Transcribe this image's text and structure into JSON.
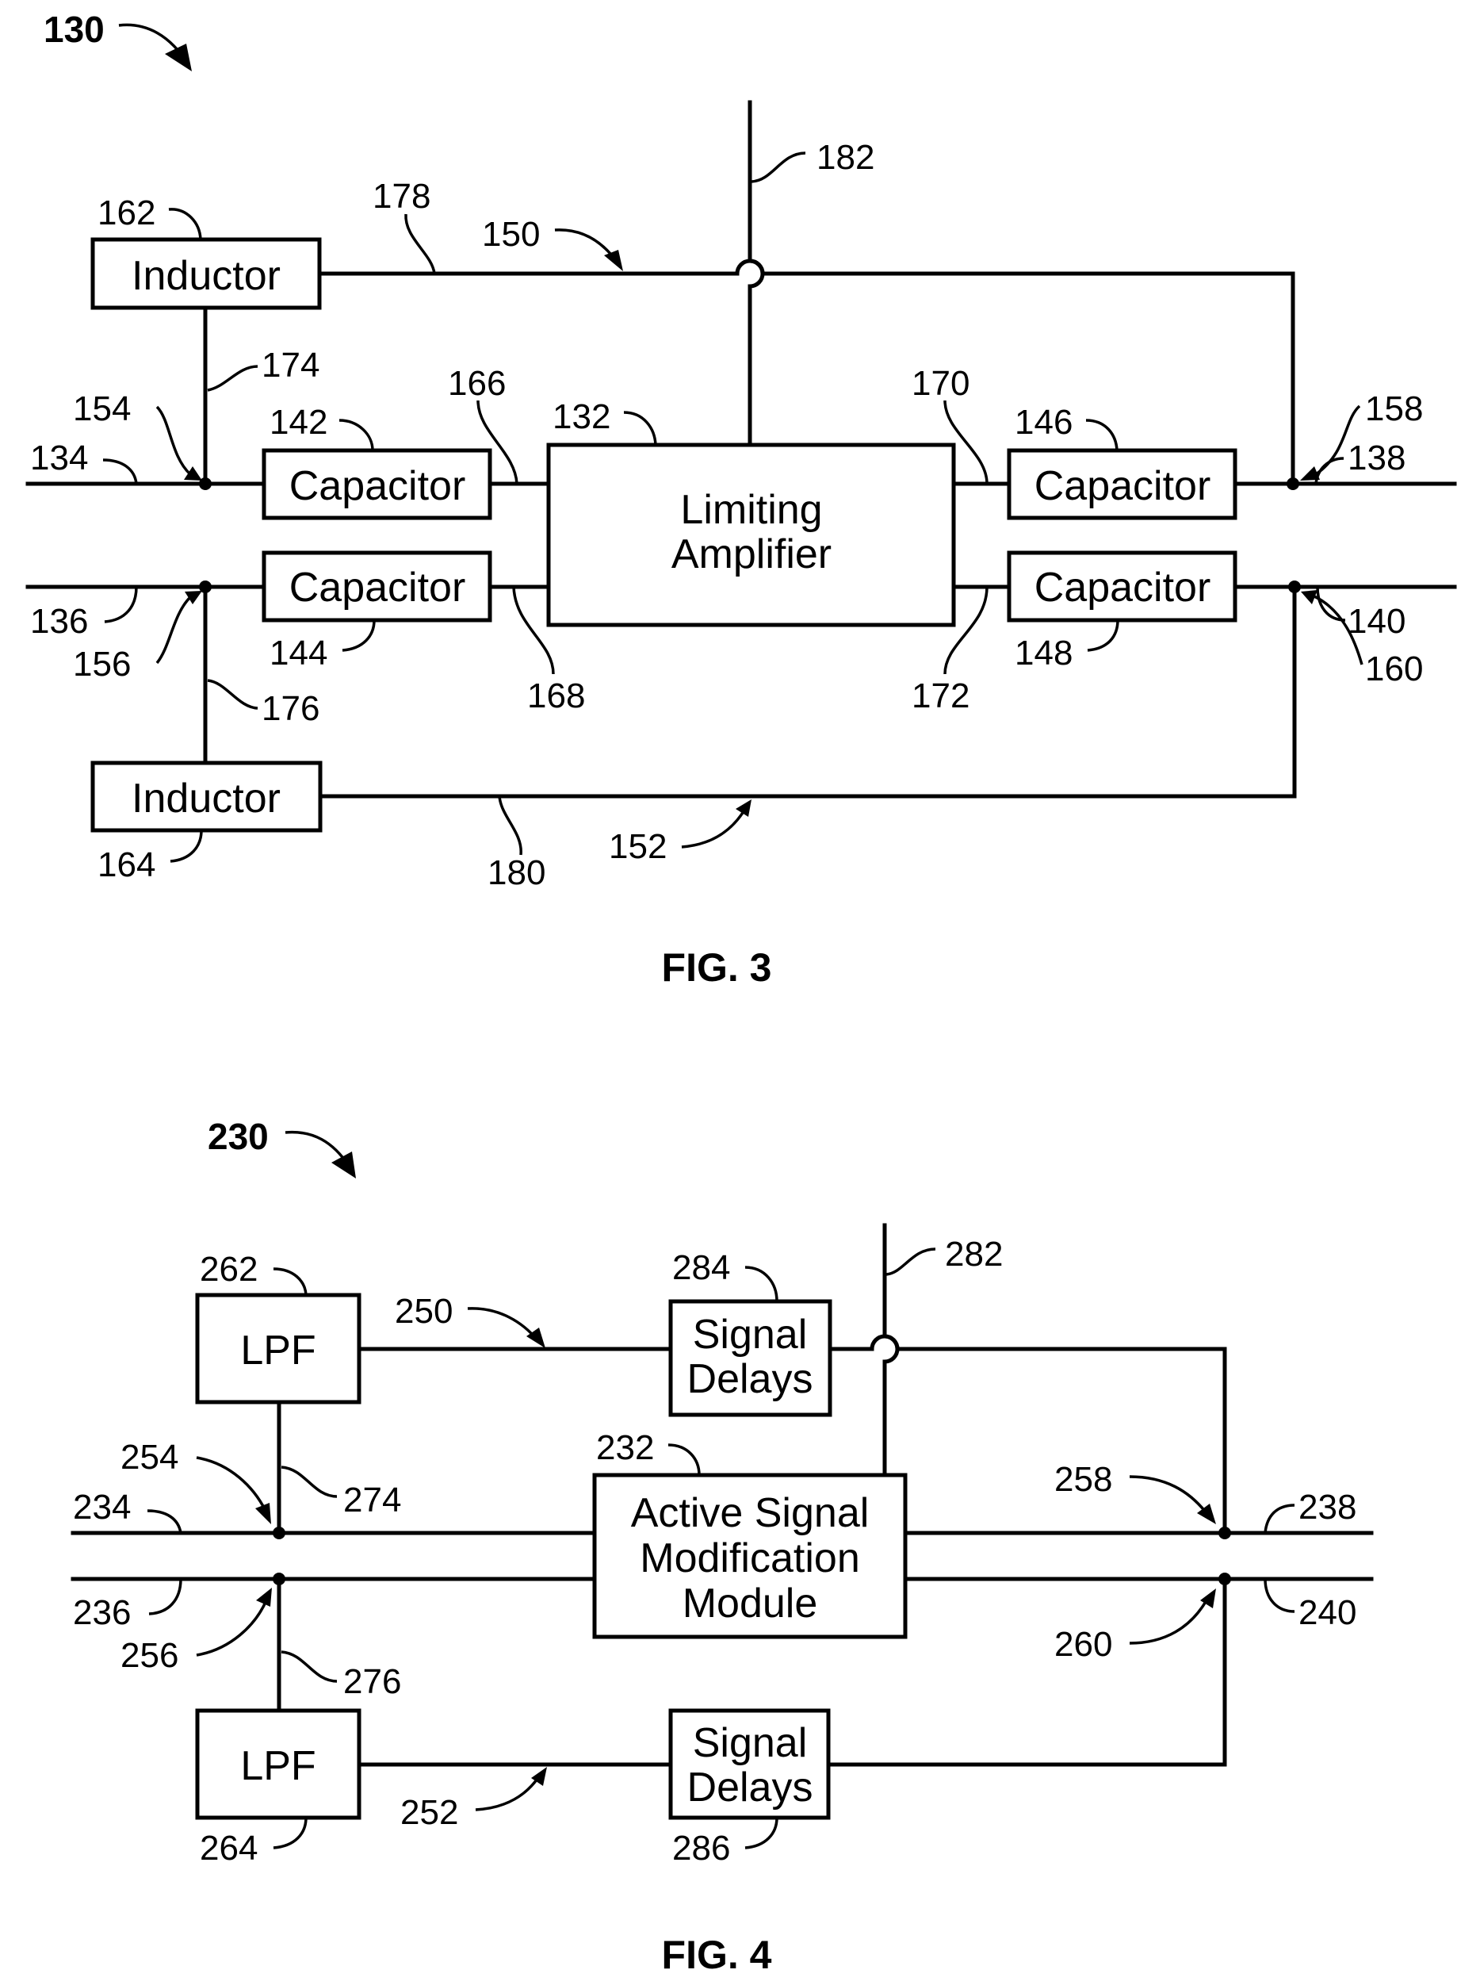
{
  "document": {
    "type": "patent-drawing-sheet",
    "figures": [
      {
        "id": "fig3",
        "caption": "FIG. 3",
        "assembly_ref": "130",
        "blocks": [
          {
            "key": "inductor_top",
            "label": "Inductor",
            "ref": "162"
          },
          {
            "key": "inductor_bottom",
            "label": "Inductor",
            "ref": "164"
          },
          {
            "key": "cap_in_top",
            "label": "Capacitor",
            "ref": "142"
          },
          {
            "key": "cap_in_bottom",
            "label": "Capacitor",
            "ref": "144"
          },
          {
            "key": "cap_out_top",
            "label": "Capacitor",
            "ref": "146"
          },
          {
            "key": "cap_out_bottom",
            "label": "Capacitor",
            "ref": "148"
          },
          {
            "key": "amplifier",
            "label_lines": [
              "Limiting",
              "Amplifier"
            ],
            "ref": "132"
          }
        ],
        "refs": {
          "in_top": "134",
          "in_bottom": "136",
          "out_top": "138",
          "out_bottom": "140",
          "node_in_top": "154",
          "node_in_bottom": "156",
          "node_out_top": "158",
          "node_out_bottom": "160",
          "path_top": "150",
          "path_bottom": "152",
          "link_174": "174",
          "link_176": "176",
          "link_178": "178",
          "link_180": "180",
          "link_166": "166",
          "link_168": "168",
          "link_170": "170",
          "link_172": "172",
          "control": "182"
        }
      },
      {
        "id": "fig4",
        "caption": "FIG. 4",
        "assembly_ref": "230",
        "blocks": [
          {
            "key": "lpf_top",
            "label": "LPF",
            "ref": "262"
          },
          {
            "key": "lpf_bottom",
            "label": "LPF",
            "ref": "264"
          },
          {
            "key": "delay_top",
            "label_lines": [
              "Signal",
              "Delays"
            ],
            "ref": "284"
          },
          {
            "key": "delay_bottom",
            "label_lines": [
              "Signal",
              "Delays"
            ],
            "ref": "286"
          },
          {
            "key": "asmm",
            "label_lines": [
              "Active Signal",
              "Modification",
              "Module"
            ],
            "ref": "232"
          }
        ],
        "refs": {
          "in_top": "234",
          "in_bottom": "236",
          "out_top": "238",
          "out_bottom": "240",
          "node_in_top": "254",
          "node_in_bottom": "256",
          "node_out_top": "258",
          "node_out_bottom": "260",
          "path_top": "250",
          "path_bottom": "252",
          "link_274": "274",
          "link_276": "276",
          "control": "282"
        }
      }
    ]
  }
}
